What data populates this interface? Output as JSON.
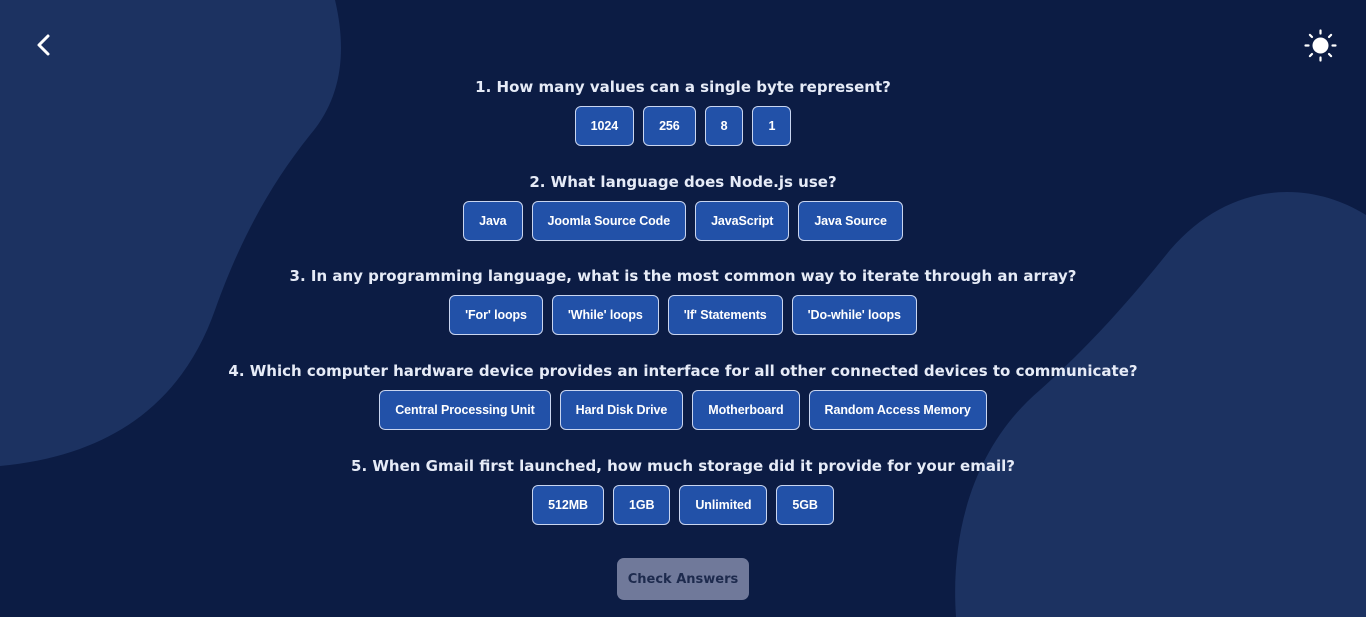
{
  "icons": {
    "back": "chevron-left-icon",
    "theme": "sun-icon"
  },
  "colors": {
    "background": "#0c1c44",
    "blob": "#1c3261",
    "option_fill": "#2251a8",
    "option_border": "#c9d5f0",
    "check_button": "#70799a"
  },
  "questions": [
    {
      "text": "1. How many values can a single byte represent?",
      "options": [
        "1024",
        "256",
        "8",
        "1"
      ]
    },
    {
      "text": "2. What language does Node.js use?",
      "options": [
        "Java",
        "Joomla Source Code",
        "JavaScript",
        "Java Source"
      ]
    },
    {
      "text": "3. In any programming language, what is the most common way to iterate through an array?",
      "options": [
        "'For' loops",
        "'While' loops",
        "'If' Statements",
        "'Do-while' loops"
      ]
    },
    {
      "text": "4. Which computer hardware device provides an interface for all other connected devices to communicate?",
      "options": [
        "Central Processing Unit",
        "Hard Disk Drive",
        "Motherboard",
        "Random Access Memory"
      ]
    },
    {
      "text": "5. When Gmail first launched, how much storage did it provide for your email?",
      "options": [
        "512MB",
        "1GB",
        "Unlimited",
        "5GB"
      ]
    }
  ],
  "check_button": {
    "label": "Check Answers"
  }
}
